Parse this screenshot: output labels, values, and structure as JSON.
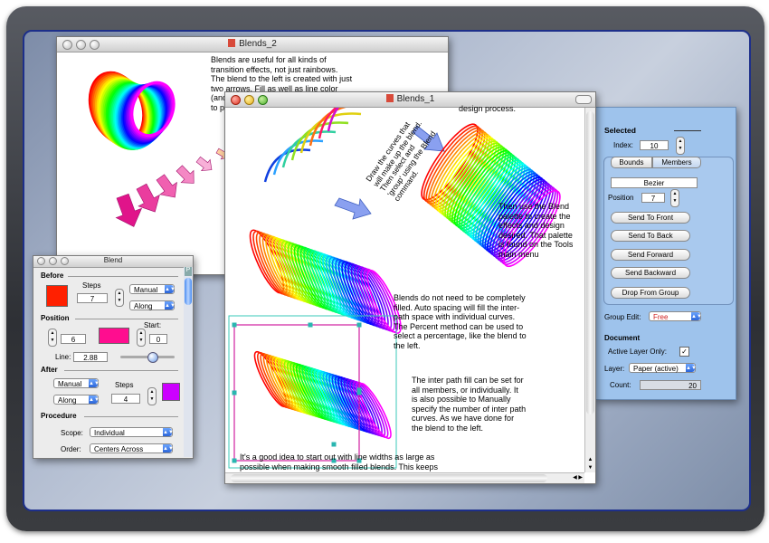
{
  "blends2": {
    "title": "Blends_2",
    "text": "Blends are useful for all kinds of\ntransition effects, not just rainbows.\nThe blend to the left is created with just\ntwo arrows.  Fill as well as line color\n(and\nto p"
  },
  "blends1": {
    "title": "Blends_1",
    "top_text": "design process.",
    "draw_text": "Draw the curves that\nwill make up the blend.\nThen select and\n'group' using the Blend\ncommand.",
    "palette_text": "Then use the Blend\npalette to create the\neffects and design\ndesired.  That palette\nis found on the Tools\nmain menu",
    "complete_text": "Blends do not need to be completely\nfilled.  Auto spacing will fill the inter-\npath space with individual curves.\nThe Percent method can be used to\nselect a percentage, like the blend to\nthe left.",
    "inter_text": "The inter path fill can be set for\nall members, or individually.  It\nis also possible to Manually\nspecify the number of inter path\ncurves.  As we have done for\nthe blend to the left.",
    "bottom_text": "It's a good idea to start out with line widths as large as\npossible when making smooth filled blends.  This keeps"
  },
  "blend_palette": {
    "title": "Blend",
    "before": "Before",
    "steps_label": "Steps",
    "before_steps": "7",
    "before_mode": "Manual",
    "before_dir": "Along",
    "before_color": "#ff2000",
    "position": "Position",
    "start_label": "Start:",
    "pos_value": "6",
    "start_value": "0",
    "pos_color": "#ff0d8f",
    "line_label": "Line:",
    "line_value": "2.88",
    "after": "After",
    "after_mode": "Manual",
    "after_dir": "Along",
    "after_steps": "4",
    "after_color": "#cc00ff",
    "procedure": "Procedure",
    "scope_label": "Scope:",
    "scope_value": "Individual",
    "order_label": "Order:",
    "order_value": "Centers Across",
    "tab_p": "P"
  },
  "panel": {
    "selected": "Selected",
    "index_label": "Index:",
    "index_value": "10",
    "tab_bounds": "Bounds",
    "tab_members": "Members",
    "bezier": "Bezier",
    "position_label": "Position",
    "position_value": "7",
    "send_front": "Send To Front",
    "send_back": "Send To Back",
    "send_forward": "Send Forward",
    "send_backward": "Send Backward",
    "drop_group": "Drop From Group",
    "group_edit_label": "Group Edit:",
    "group_edit_value": "Free",
    "document": "Document",
    "active_layer_label": "Active Layer Only:",
    "active_layer_check": "✓",
    "layer_label": "Layer:",
    "layer_value": "Paper (active)",
    "count_label": "Count:",
    "count_value": "20"
  }
}
